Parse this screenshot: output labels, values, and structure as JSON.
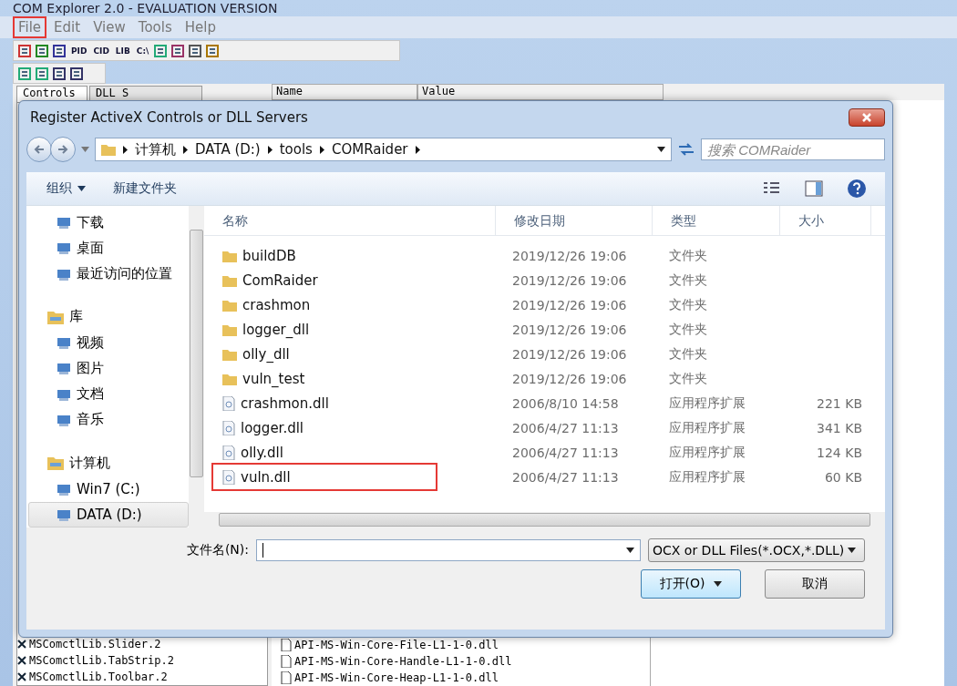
{
  "app": {
    "title": "COM Explorer 2.0 - EVALUATION VERSION",
    "menu": [
      {
        "label": "File",
        "annotated": true
      },
      {
        "label": "Edit",
        "annotated": false
      },
      {
        "label": "View",
        "annotated": false
      },
      {
        "label": "Tools",
        "annotated": false
      },
      {
        "label": "Help",
        "annotated": false
      }
    ],
    "toolbar_text_buttons": [
      "PID",
      "CID",
      "LIB",
      "C:\\"
    ],
    "tabs": [
      {
        "label": "Controls",
        "selected": true
      },
      {
        "label": "DLL S",
        "selected": false
      }
    ],
    "columns": [
      "Name",
      "Value"
    ],
    "controls_list": [
      "MSComctlLib.Slider.2",
      "MSComctlLib.TabStrip.2",
      "MSComctlLib.Toolbar.2"
    ],
    "dll_tree": [
      "API-MS-Win-Core-File-L1-1-0.dll",
      "API-MS-Win-Core-Handle-L1-1-0.dll",
      "API-MS-Win-Core-Heap-L1-1-0.dll"
    ]
  },
  "dialog": {
    "title": "Register ActiveX Controls or DLL Servers",
    "breadcrumb": [
      "计算机",
      "DATA (D:)",
      "tools",
      "COMRaider"
    ],
    "search": {
      "placeholder": "搜索 COMRaider"
    },
    "commands": [
      {
        "label": "组织",
        "dropdown": true
      },
      {
        "label": "新建文件夹",
        "dropdown": false
      }
    ],
    "nav": [
      {
        "label": "下载",
        "kind": "item",
        "selected": false
      },
      {
        "label": "桌面",
        "kind": "item",
        "selected": false
      },
      {
        "label": "最近访问的位置",
        "kind": "item",
        "selected": false
      },
      {
        "label": "库",
        "kind": "header",
        "selected": false
      },
      {
        "label": "视频",
        "kind": "item",
        "selected": false
      },
      {
        "label": "图片",
        "kind": "item",
        "selected": false
      },
      {
        "label": "文档",
        "kind": "item",
        "selected": false
      },
      {
        "label": "音乐",
        "kind": "item",
        "selected": false
      },
      {
        "label": "计算机",
        "kind": "header",
        "selected": false
      },
      {
        "label": "Win7 (C:)",
        "kind": "item",
        "selected": false
      },
      {
        "label": "DATA (D:)",
        "kind": "item",
        "selected": true
      }
    ],
    "columns": [
      "名称",
      "修改日期",
      "类型",
      "大小"
    ],
    "files": [
      {
        "name": "buildDB",
        "date": "2019/12/26 19:06",
        "type": "文件夹",
        "kind": "folder",
        "annotated": false
      },
      {
        "name": "ComRaider",
        "date": "2019/12/26 19:06",
        "type": "文件夹",
        "kind": "folder",
        "annotated": false
      },
      {
        "name": "crashmon",
        "date": "2019/12/26 19:06",
        "type": "文件夹",
        "kind": "folder",
        "annotated": false
      },
      {
        "name": "logger_dll",
        "date": "2019/12/26 19:06",
        "type": "文件夹",
        "kind": "folder",
        "annotated": false
      },
      {
        "name": "olly_dll",
        "date": "2019/12/26 19:06",
        "type": "文件夹",
        "kind": "folder",
        "annotated": false
      },
      {
        "name": "vuln_test",
        "date": "2019/12/26 19:06",
        "type": "文件夹",
        "kind": "folder",
        "annotated": false
      },
      {
        "name": "crashmon.dll",
        "date": "2006/8/10 14:58",
        "type": "应用程序扩展",
        "size": "221 KB",
        "kind": "file",
        "annotated": false
      },
      {
        "name": "logger.dll",
        "date": "2006/4/27 11:13",
        "type": "应用程序扩展",
        "size": "341 KB",
        "kind": "file",
        "annotated": false
      },
      {
        "name": "olly.dll",
        "date": "2006/4/27 11:13",
        "type": "应用程序扩展",
        "size": "124 KB",
        "kind": "file",
        "annotated": false
      },
      {
        "name": "vuln.dll",
        "date": "2006/4/27 11:13",
        "type": "应用程序扩展",
        "size": "60 KB",
        "kind": "file",
        "annotated": true
      }
    ],
    "filename_label": "文件名(N):",
    "filter": "OCX or DLL Files(*.OCX,*.DLL)",
    "open_button": "打开(O)",
    "cancel_button": "取消"
  }
}
